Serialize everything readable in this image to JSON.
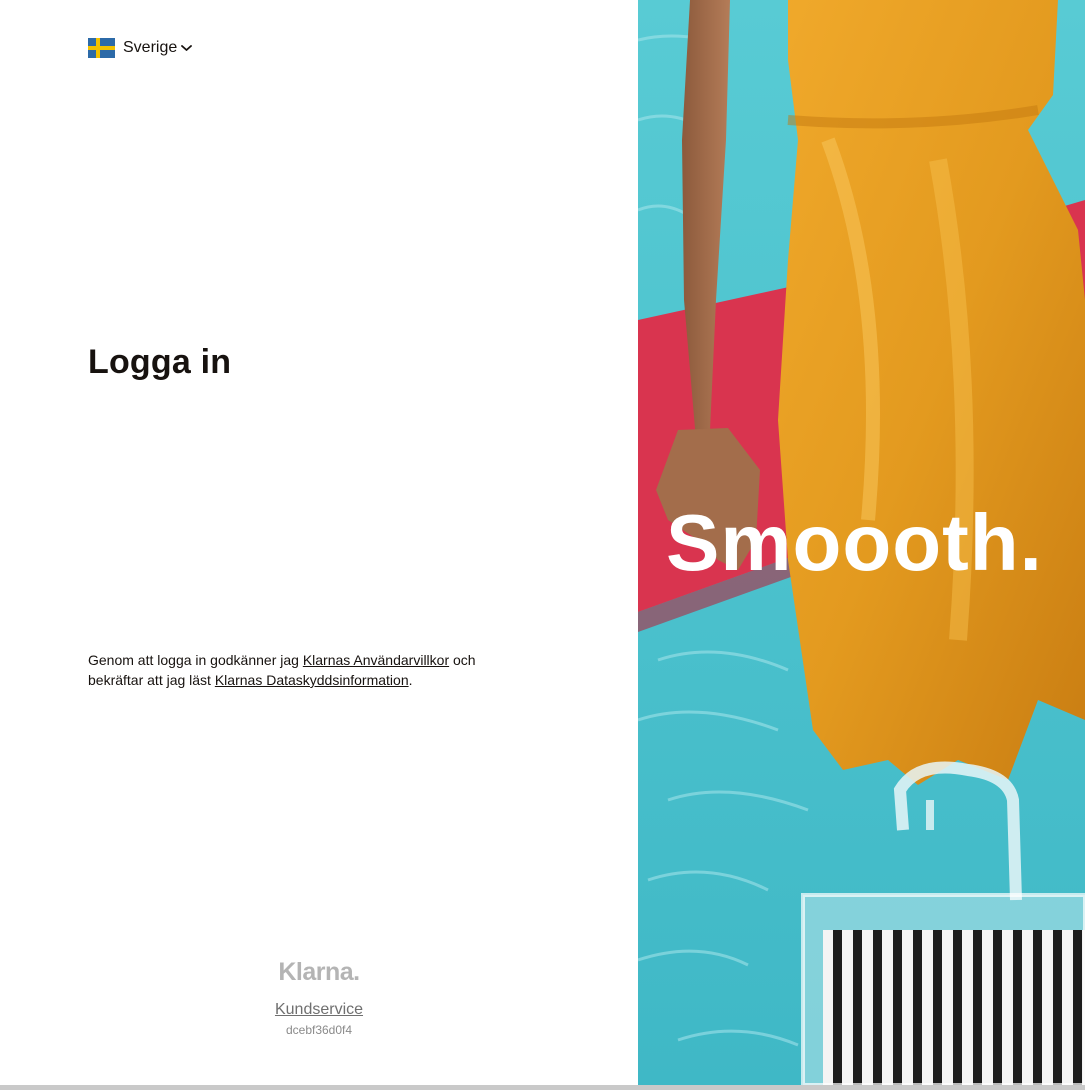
{
  "country": {
    "label": "Sverige",
    "flag_icon": "sweden-flag-icon",
    "chevron_icon": "chevron-down-icon"
  },
  "login": {
    "title": "Logga in"
  },
  "terms": {
    "text_before": "Genom att logga in godkänner jag ",
    "user_terms_link": "Klarnas Användarvillkor",
    "text_middle": " och bekräftar att jag läst ",
    "privacy_link": "Klarnas Dataskyddsinformation",
    "text_after": "."
  },
  "footer": {
    "logo_text": "Klarna.",
    "support_link": "Kundservice",
    "build_id": "dcebf36d0f4"
  },
  "hero": {
    "headline": "Smoooth."
  },
  "colors": {
    "text": "#17120f",
    "water": "#49c4cf",
    "dress": "#e8a12a",
    "platform": "#d9344f",
    "logo_grey": "#b4b4b4"
  }
}
